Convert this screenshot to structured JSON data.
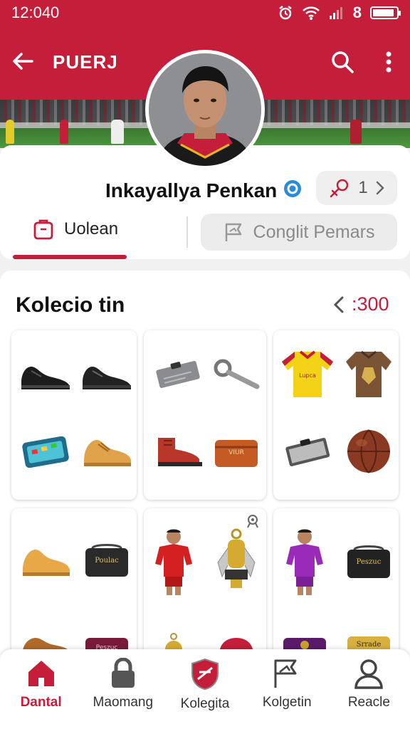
{
  "status": {
    "time": "12:040",
    "signal_text": "8",
    "battery_level": 0.9
  },
  "appbar": {
    "title": "PUERJ"
  },
  "profile": {
    "name": "Inkayallya Penkan",
    "follow_count": "1"
  },
  "tabs": {
    "left_label": "Uolean",
    "right_label": "Conglit Pemars"
  },
  "collection": {
    "title": "Kolecio tin",
    "count": ":300"
  },
  "items": {
    "pouch_1": "Poulac",
    "pouch_2": "Peszuc",
    "pouch_3": "Srrade",
    "pouch_4": "VIUR",
    "shirt_text": "Lupca"
  },
  "nav": {
    "items": [
      {
        "label": "Dantal",
        "icon": "home-icon",
        "active": true
      },
      {
        "label": "Maomang",
        "icon": "lock-icon",
        "active": false
      },
      {
        "label": "Kolegita",
        "icon": "shield-icon",
        "active": false
      },
      {
        "label": "Kolgetin",
        "icon": "flag-icon",
        "active": false
      },
      {
        "label": "Reacle",
        "icon": "person-icon",
        "active": false
      }
    ]
  },
  "colors": {
    "brand": "#c41e3a",
    "verified": "#2a8bd6"
  }
}
